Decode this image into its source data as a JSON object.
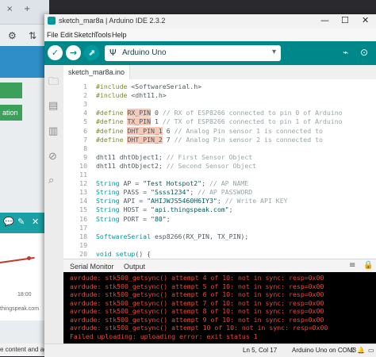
{
  "background": {
    "tab_plus": "+",
    "tab_close": "×",
    "nav_icons": [
      "⚙",
      "⇅"
    ],
    "green_button_1": "",
    "green_button_2": "ation",
    "teal_icons": [
      "💬",
      "✎",
      "✕"
    ],
    "chart_time": "18:00",
    "site_text": "thingspeak.com",
    "ad_text": "e content and ads,"
  },
  "window": {
    "title": "sketch_mar8a | Arduino IDE 2.3.2",
    "controls": [
      "—",
      "☐",
      "✕"
    ]
  },
  "menu": [
    "File",
    "Edit",
    "Sketch",
    "Tools",
    "Help"
  ],
  "toolbar": {
    "verify_icon": "✓",
    "upload_icon": "→",
    "debug_icon": "⬈",
    "board_icon": "Ψ",
    "board_label": "Arduino Uno",
    "board_caret": "▾",
    "plotter_icon": "⌁",
    "serial_monitor_icon": "⊙"
  },
  "sidebar_icons": [
    "folder-icon",
    "boards-manager-icon",
    "library-manager-icon",
    "debug-icon",
    "search-icon"
  ],
  "sidebar_glyphs": [
    "🗀",
    "▤",
    "▥",
    "⊘",
    "⌕"
  ],
  "file_tab": "sketch_mar8a.ino",
  "code_lines": [
    {
      "n": "1",
      "html": "<span class=\"kw2\">#include</span> &lt;SoftwareSerial.h&gt;"
    },
    {
      "n": "2",
      "html": "<span class=\"kw2\">#include</span> &lt;dht11.h&gt;"
    },
    {
      "n": "3",
      "html": ""
    },
    {
      "n": "4",
      "html": "<span class=\"kw2\">#define</span> <span class=\"hl\">RX_PIN</span> 0 <span class=\"cm\">// RX of ESP8266 connected to pin 0 of Arduino</span>"
    },
    {
      "n": "5",
      "html": "<span class=\"kw2\">#define</span> <span class=\"hl\">TX_PIN</span> 1 <span class=\"cm\">// TX of ESP8266 connected to pin 1 of Arduino</span>"
    },
    {
      "n": "6",
      "html": "<span class=\"kw2\">#define</span> <span class=\"hl\">DHT_PIN_1</span> 6 <span class=\"cm\">// Analog Pin sensor 1 is connected to</span>"
    },
    {
      "n": "7",
      "html": "<span class=\"kw2\">#define</span> <span class=\"hl\">DHT_PIN_2</span> 7 <span class=\"cm\">// Analog Pin sensor 2 is connected to</span>"
    },
    {
      "n": "8",
      "html": ""
    },
    {
      "n": "9",
      "html": "dht11 dhtObject1; <span class=\"cm\">// First Sensor Object</span>"
    },
    {
      "n": "10",
      "html": "dht11 dhtObject2; <span class=\"cm\">// Second Sensor Object</span>"
    },
    {
      "n": "11",
      "html": ""
    },
    {
      "n": "12",
      "html": "<span class=\"ty\">String</span> AP = <span class=\"str\">\"Test Hotspot2\"</span>; <span class=\"cm\">// AP NAME</span>"
    },
    {
      "n": "13",
      "html": "<span class=\"ty\">String</span> PASS = <span class=\"str\">\"Ssss1234\"</span>; <span class=\"cm\">// AP PASSWORD</span>"
    },
    {
      "n": "14",
      "html": "<span class=\"ty\">String</span> API = <span class=\"str\">\"AHIJWJS5460H6IY3\"</span>; <span class=\"cm\">// Write API KEY</span>"
    },
    {
      "n": "15",
      "html": "<span class=\"ty\">String</span> HOST = <span class=\"str\">\"api.thingspeak.com\"</span>;"
    },
    {
      "n": "16",
      "html": "<span class=\"ty\">String</span> PORT = <span class=\"str\">\"80\"</span>;"
    },
    {
      "n": "17",
      "html": ""
    },
    {
      "n": "18",
      "html": "<span class=\"ty\">SoftwareSerial</span> esp8266(RX_PIN, TX_PIN);"
    },
    {
      "n": "19",
      "html": ""
    },
    {
      "n": "20",
      "html": "<span class=\"kw\">void</span> <span class=\"kw\">setup</span>() {"
    }
  ],
  "output_tabs": {
    "serial_monitor": "Serial Monitor",
    "output": "Output",
    "list_icon": "≡",
    "lock_icon": "🔒"
  },
  "console_lines": [
    "avrdude: stk500_getsync() attempt 4 of 10: not in sync: resp=0x00",
    "avrdude: stk500_getsync() attempt 5 of 10: not in sync: resp=0x00",
    "avrdude: stk500_getsync() attempt 6 of 10: not in sync: resp=0x00",
    "avrdude: stk500_getsync() attempt 7 of 10: not in sync: resp=0x00",
    "avrdude: stk500_getsync() attempt 8 of 10: not in sync: resp=0x00",
    "avrdude: stk500_getsync() attempt 9 of 10: not in sync: resp=0x00",
    "avrdude: stk500_getsync() attempt 10 of 10: not in sync: resp=0x00",
    "Failed uploading: uploading error: exit status 1"
  ],
  "status": {
    "cursor": "Ln 5, Col 17",
    "board_port": "Arduino Uno on COM3",
    "notifications": "2",
    "bell_icon": "🔔",
    "layout_icon": "▭"
  },
  "colors": {
    "accent": "#00878a",
    "console_error": "#e74c3c",
    "highlight": "#f6c8b8"
  }
}
